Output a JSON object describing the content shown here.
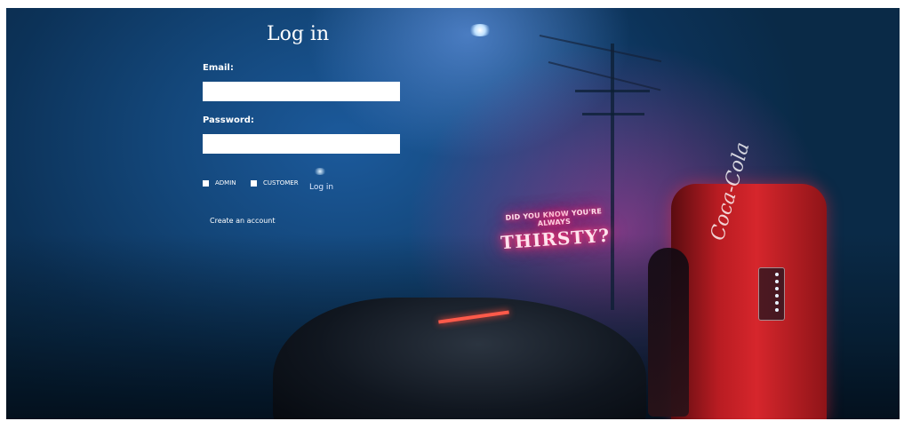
{
  "login": {
    "title": "Log in",
    "email_label": "Email:",
    "email_value": "",
    "password_label": "Password:",
    "password_value": "",
    "roles": [
      {
        "label": "ADMIN",
        "checked": false
      },
      {
        "label": "CUSTOMER",
        "checked": false
      }
    ],
    "submit_label": "Log in",
    "create_account_link": "Create an account"
  },
  "background": {
    "neon_small": "DID YOU KNOW YOU'RE ALWAYS",
    "neon_big": "THIRSTY?",
    "vending_logo": "Coca-Cola"
  },
  "colors": {
    "sky": "#134679",
    "neon": "#ff2a6a",
    "vending_red": "#d6262c",
    "text": "#ffffff"
  }
}
